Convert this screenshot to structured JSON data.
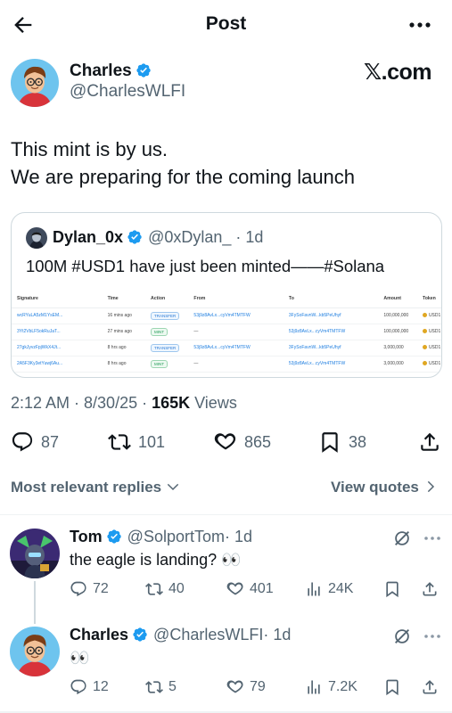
{
  "header": {
    "title": "Post"
  },
  "post": {
    "author_name": "Charles",
    "author_handle": "@CharlesWLFI",
    "source_label": "𝕏.com",
    "text_line1": "This mint is by us.",
    "text_line2": "We are preparing for the coming launch",
    "time": "2:12 AM · 8/30/25 · ",
    "views_count": "165K",
    "views_label": " Views",
    "stats": {
      "replies": "87",
      "reposts": "101",
      "likes": "865",
      "bookmarks": "38"
    }
  },
  "quote": {
    "author_name": "Dylan_0x",
    "author_handle": "@0xDylan_",
    "age": "· 1d",
    "text": "100M #USD1 have just been minted——#Solana",
    "table": {
      "headers": [
        "Signature",
        "Time",
        "Action",
        "From",
        "To",
        "Amount",
        "Token"
      ],
      "rows": [
        [
          "wcRYuLA5zM1YsEM...",
          "16 mins ago",
          "TRANSFER",
          "53j9z8AvLx...cyVm4TMTFW",
          "3FySoFavnW...kb5PeUhyf",
          "100,000,000",
          "USD1"
        ],
        [
          "3Yt2VbLF5okRuJaT...",
          "27 mins ago",
          "MINT",
          "—",
          "53j9z8AvLx...cyVm4TMTFW",
          "100,000,000",
          "USD1"
        ],
        [
          "27gkJyvzFpjWkX4Jt...",
          "8 hrs ago",
          "TRANSFER",
          "53j9z8AvLx...cyVm4TMTFW",
          "3FySoFavnW...kb5PeUhyf",
          "3,000,000",
          "USD1"
        ],
        [
          "2A5F3Ky3etYuwj6Au...",
          "8 hrs ago",
          "MINT",
          "—",
          "53j9z8AvLx...cyVm4TMTFW",
          "3,000,000",
          "USD1"
        ]
      ]
    }
  },
  "replies_bar": {
    "sort_label": "Most relevant replies",
    "view_quotes": "View quotes"
  },
  "replies": [
    {
      "name": "Tom",
      "handle": "@SolportTom",
      "age": "· 1d",
      "text": "the eagle is landing? 👀",
      "stats": {
        "replies": "72",
        "reposts": "40",
        "likes": "401",
        "views": "24K"
      }
    },
    {
      "name": "Charles",
      "handle": "@CharlesWLFI",
      "age": "· 1d",
      "text": "👀",
      "stats": {
        "replies": "12",
        "reposts": "5",
        "likes": "79",
        "views": "7.2K"
      }
    }
  ],
  "colors": {
    "verified": "#1d9bf0",
    "secondary_text": "#536471",
    "primary_text": "#0f1419",
    "border": "#cfd9de"
  },
  "icons": [
    "back-arrow-icon",
    "more-icon",
    "verified-icon",
    "reply-icon",
    "repost-icon",
    "like-icon",
    "bookmark-icon",
    "share-icon",
    "views-icon",
    "grok-icon",
    "chevron-down-icon",
    "chevron-right-icon"
  ]
}
